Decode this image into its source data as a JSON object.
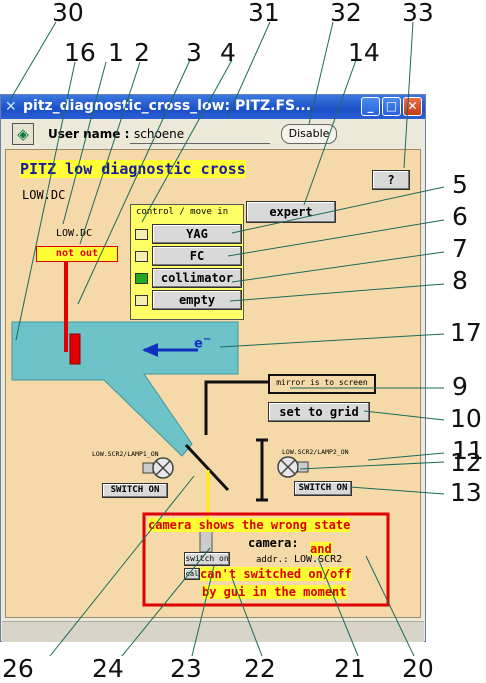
{
  "callouts": {
    "n30": "30",
    "n31": "31",
    "n32": "32",
    "n33": "33",
    "n16": "16",
    "n1": "1",
    "n2": "2",
    "n3": "3",
    "n4": "4",
    "n14": "14",
    "n5": "5",
    "n6": "6",
    "n7": "7",
    "n8": "8",
    "n17": "17",
    "n9": "9",
    "n10": "10",
    "n11": "11",
    "n12": "12",
    "n13": "13",
    "n26": "26",
    "n24": "24",
    "n23": "23",
    "n22": "22",
    "n21": "21",
    "n20": "20"
  },
  "window": {
    "title": "pitz_diagnostic_cross_low: PITZ.FS...",
    "user_label": "User name :",
    "user_value": "schoene",
    "disable_label": "Disable"
  },
  "panel": {
    "heading": "PITZ low diagnostic cross",
    "location": "LOW.DC",
    "help_label": "?",
    "device_label": "LOW.DC",
    "device_state": "not out"
  },
  "control": {
    "header": "control / move in",
    "expert_label": "expert",
    "items": [
      {
        "label": "YAG",
        "active": false
      },
      {
        "label": "FC",
        "active": false
      },
      {
        "label": "collimator",
        "active": true
      },
      {
        "label": "empty",
        "active": false
      }
    ]
  },
  "beam": {
    "label": "e",
    "charge": "−"
  },
  "mirror": {
    "status": "mirror is to screen",
    "grid_label": "set to grid"
  },
  "lamp1": {
    "label": "LOW.SCR2/LAMP1_ON",
    "switch_label": "SWITCH ON"
  },
  "lamp2": {
    "label": "LOW.SCR2/LAMP2_ON",
    "switch_label": "SWITCH ON"
  },
  "camera": {
    "warning": "camera shows the wrong state",
    "label": "camera:",
    "and_text": "and",
    "addr_label": "addr.:",
    "addr_value": "LOW.SCR2",
    "switch_label": "switch on",
    "cal_label": "cal",
    "note_line1": "can't switched on/off",
    "note_line2": "by gui in the moment"
  },
  "colors": {
    "panel_bg": "#f6d9a8",
    "beam": "#6ec3c8",
    "warning_text": "#e00000",
    "highlight": "#ffff33",
    "led_active": "#22aa22"
  }
}
